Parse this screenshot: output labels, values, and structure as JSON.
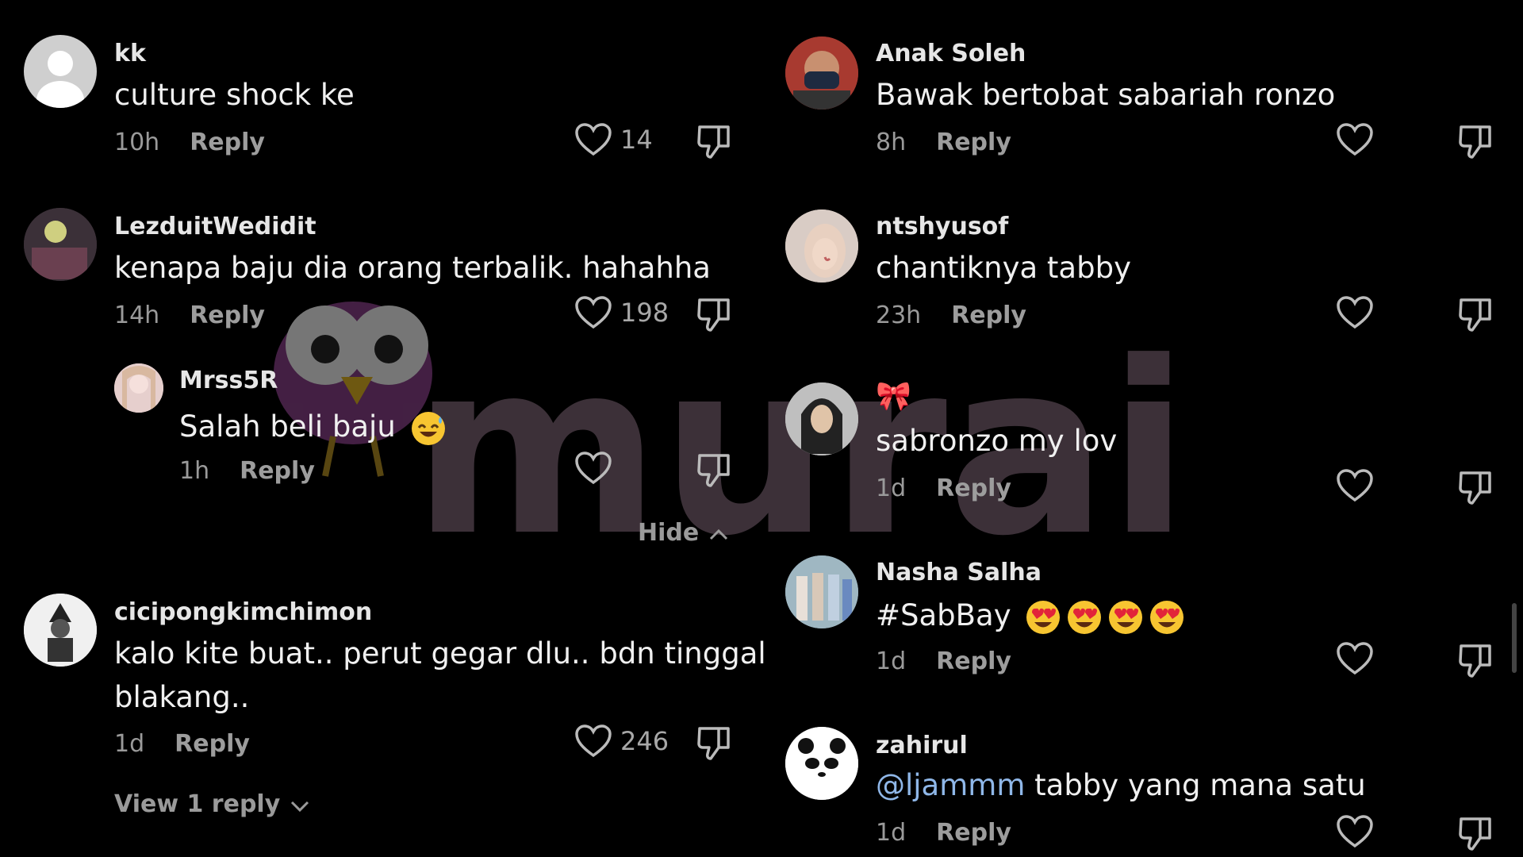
{
  "colors": {
    "background": "#000000",
    "mention": "#8fb7e8",
    "muted": "#9a9a9a",
    "watermark": "#6d5866"
  },
  "left": {
    "comments": [
      {
        "username": "kk",
        "text": "culture shock ke",
        "time": "10h",
        "reply_label": "Reply",
        "likes": "14"
      },
      {
        "username": "LezduitWedidit",
        "text": "kenapa baju dia orang terbalik. hahahha",
        "time": "14h",
        "reply_label": "Reply",
        "likes": "198",
        "replies": [
          {
            "username": "Mrss5R",
            "text": "Salah beli baju",
            "emoji": "sweat-smile-emoji",
            "time": "1h",
            "reply_label": "Reply",
            "likes": ""
          }
        ],
        "hide_label": "Hide"
      },
      {
        "username": "cicipongkimchimon",
        "text_line1": "kalo kite buat.. perut gegar dlu.. bdn tinggal",
        "text_line2": "blakang..",
        "time": "1d",
        "reply_label": "Reply",
        "likes": "246",
        "view_replies_label": "View 1 reply"
      }
    ]
  },
  "right": {
    "comments": [
      {
        "username": "Anak Soleh",
        "text": "Bawak bertobat sabariah ronzo",
        "time": "8h",
        "reply_label": "Reply"
      },
      {
        "username": "ntshyusof",
        "text": "chantiknya tabby",
        "time": "23h",
        "reply_label": "Reply"
      },
      {
        "username": "🎀",
        "text": "sabronzo my lov",
        "time": "1d",
        "reply_label": "Reply"
      },
      {
        "username": "Nasha Salha",
        "text": "#SabBay",
        "emojis": [
          "heart-eyes-emoji",
          "heart-eyes-emoji",
          "heart-eyes-emoji",
          "heart-eyes-emoji"
        ],
        "time": "1d",
        "reply_label": "Reply"
      },
      {
        "username": "zahirul",
        "mention": "@ljammm",
        "text": " tabby yang mana satu",
        "time": "1d",
        "reply_label": "Reply"
      }
    ]
  },
  "watermark": {
    "text": "murai"
  }
}
